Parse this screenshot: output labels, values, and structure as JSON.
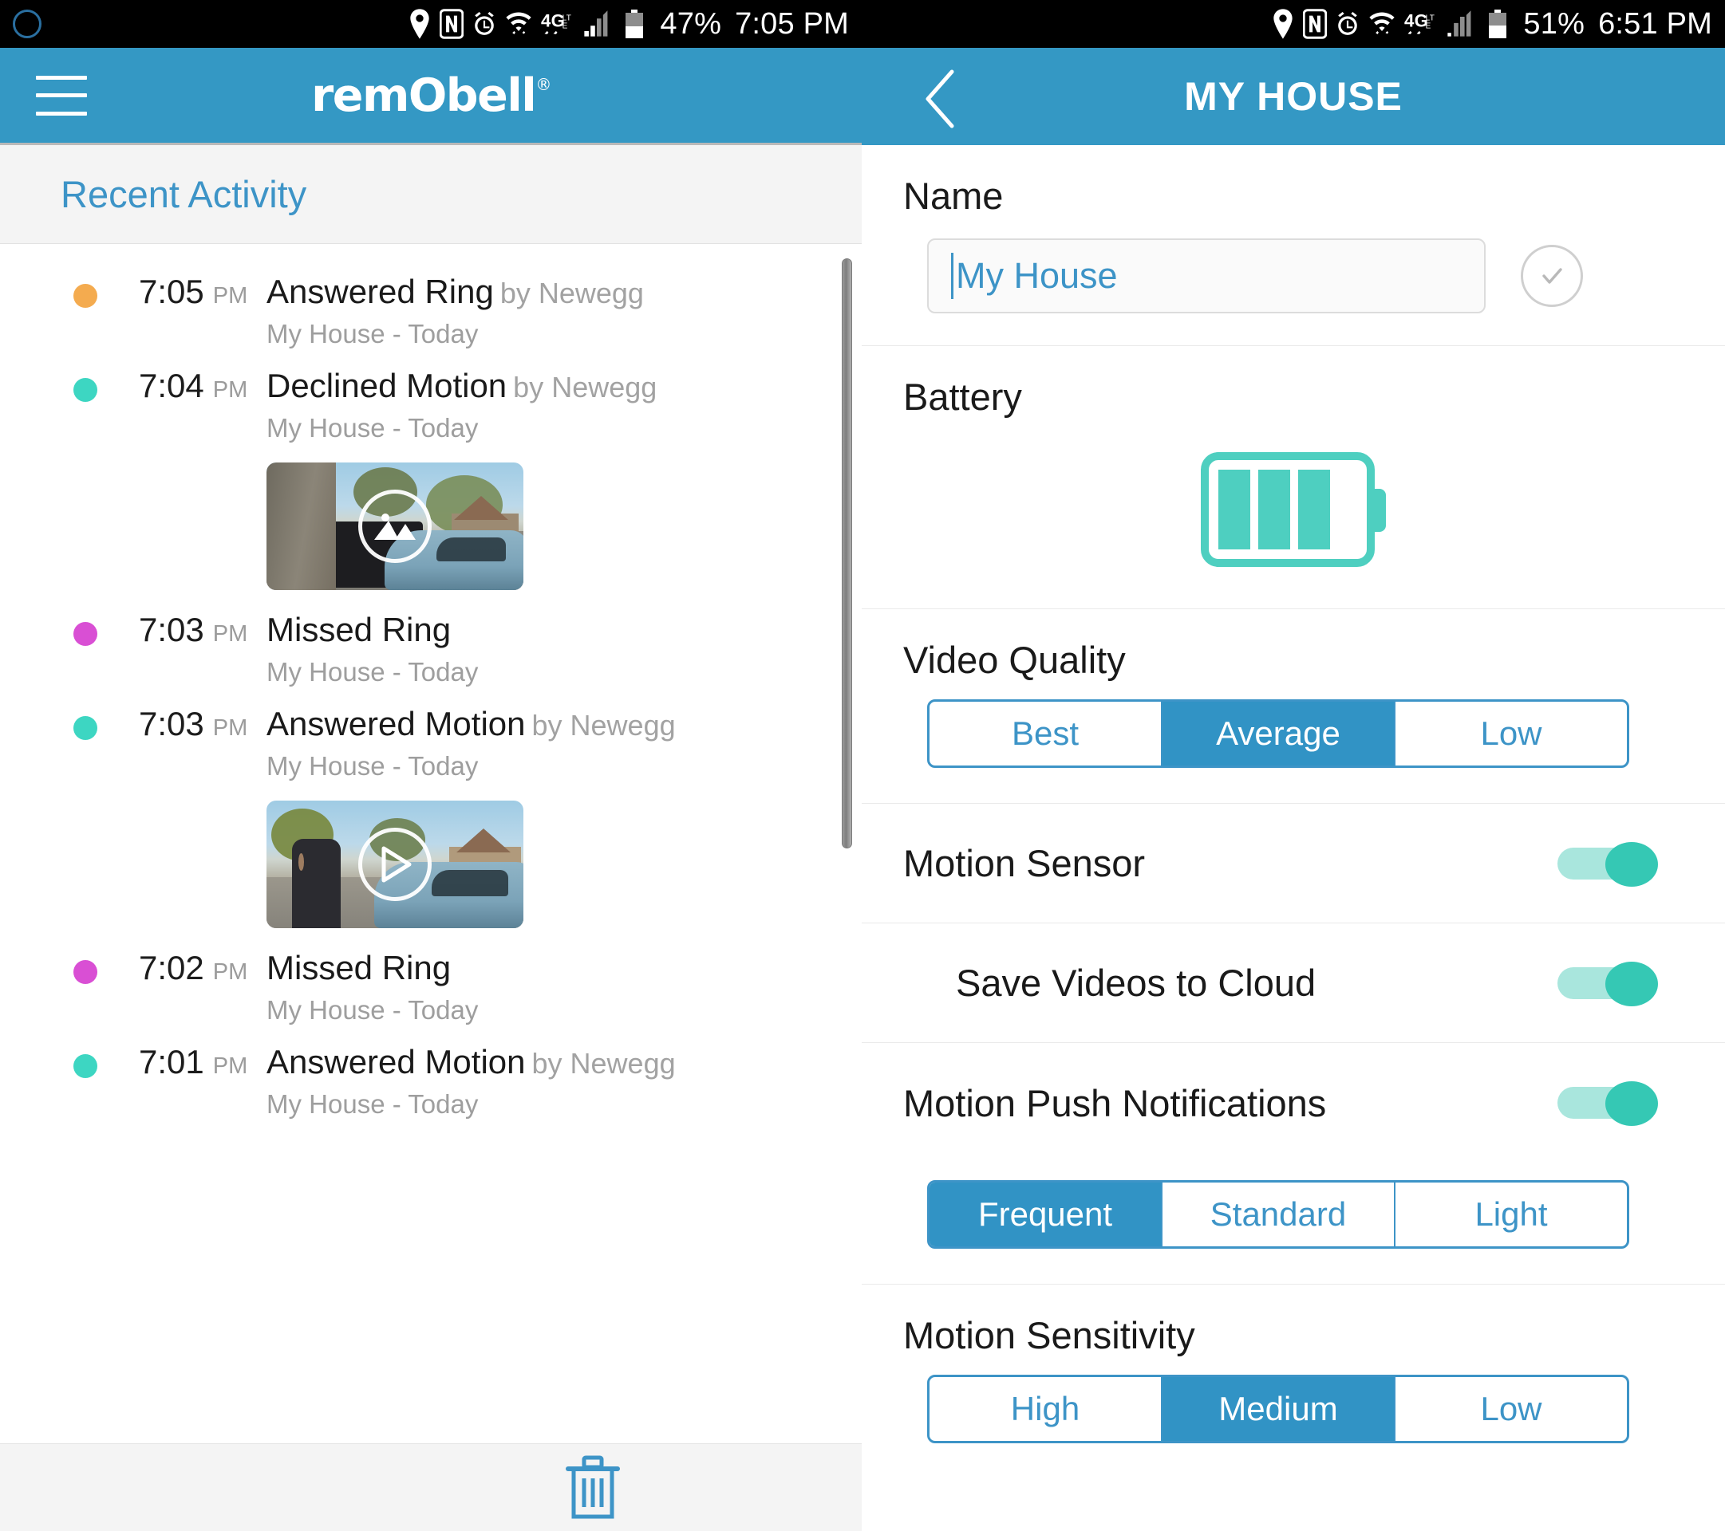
{
  "left_status": {
    "icons": [
      "location-icon",
      "nfc-icon",
      "alarm-icon",
      "wifi-icon",
      "4glte-icon",
      "signal-icon"
    ],
    "battery_percent": "47%",
    "time": "7:05 PM"
  },
  "right_status": {
    "icons": [
      "location-icon",
      "nfc-icon",
      "alarm-icon",
      "wifi-icon",
      "4glte-icon",
      "signal-icon"
    ],
    "battery_percent": "51%",
    "time": "6:51 PM"
  },
  "left_app": {
    "menu_icon": "hamburger-menu-icon",
    "logo_text": "remObell",
    "logo_registered": "®",
    "section_title": "Recent Activity",
    "delete_icon": "trash-icon"
  },
  "right_app": {
    "back_icon": "chevron-left-icon",
    "title": "MY HOUSE"
  },
  "activity": [
    {
      "time": "7:05",
      "ampm": "PM",
      "dot_color": "#f4ab4f",
      "title": "Answered Ring",
      "by": "by Newegg",
      "sub": "My House - Today",
      "thumb": null
    },
    {
      "time": "7:04",
      "ampm": "PM",
      "dot_color": "#3dd6c2",
      "title": "Declined Motion",
      "by": "by Newegg",
      "sub": "My House - Today",
      "thumb": "image-thumbnail",
      "thumb_overlay_icon": "image-icon"
    },
    {
      "time": "7:03",
      "ampm": "PM",
      "dot_color": "#d94fd4",
      "title": "Missed Ring",
      "by": "",
      "sub": "My House - Today",
      "thumb": null
    },
    {
      "time": "7:03",
      "ampm": "PM",
      "dot_color": "#3dd6c2",
      "title": "Answered Motion",
      "by": "by Newegg",
      "sub": "My House - Today",
      "thumb": "video-thumbnail",
      "thumb_overlay_icon": "play-icon"
    },
    {
      "time": "7:02",
      "ampm": "PM",
      "dot_color": "#d94fd4",
      "title": "Missed Ring",
      "by": "",
      "sub": "My House - Today",
      "thumb": null
    },
    {
      "time": "7:01",
      "ampm": "PM",
      "dot_color": "#3dd6c2",
      "title": "Answered Motion",
      "by": "by Newegg",
      "sub": "My House - Today",
      "thumb": null
    }
  ],
  "settings": {
    "name": {
      "label": "Name",
      "value": "My House",
      "placeholder": "Name",
      "confirm_icon": "check-circle-icon"
    },
    "battery": {
      "label": "Battery",
      "icon": "battery-icon",
      "bars_filled": 3,
      "bars_total": 4,
      "color": "#4ecfc0"
    },
    "video_quality": {
      "label": "Video Quality",
      "options": [
        "Best",
        "Average",
        "Low"
      ],
      "selected": "Average"
    },
    "motion_sensor": {
      "label": "Motion Sensor",
      "state": "on"
    },
    "save_videos": {
      "label": "Save Videos to Cloud",
      "state": "on"
    },
    "motion_push": {
      "label": "Motion Push Notifications",
      "state": "on",
      "options": [
        "Frequent",
        "Standard",
        "Light"
      ],
      "selected": "Frequent"
    },
    "motion_sensitivity": {
      "label": "Motion Sensitivity",
      "options": [
        "High",
        "Medium",
        "Low"
      ],
      "selected": "Medium"
    }
  },
  "colors": {
    "brand_blue": "#3498c4",
    "accent_teal": "#4ecfc0",
    "link_blue": "#3d94c7"
  }
}
